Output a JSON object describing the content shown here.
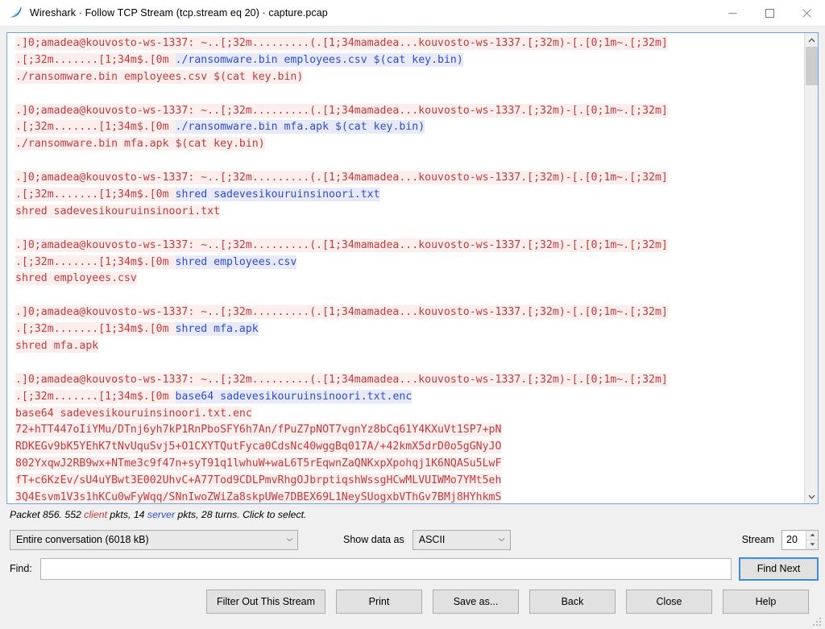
{
  "window": {
    "title": "Wireshark · Follow TCP Stream (tcp.stream eq 20) · capture.pcap",
    "logo_icon": "wireshark-shark-fin-icon",
    "minimize_icon": "minimize-icon",
    "maximize_icon": "maximize-icon",
    "close_icon": "close-icon"
  },
  "colors": {
    "server_text": "#c23b3b",
    "server_bg": "#fdeeee",
    "client_text": "#2b4fcf",
    "client_bg": "#e9eaf9",
    "pane_border": "#69a5e8",
    "focus_border": "#3d8bdb"
  },
  "stream_content": {
    "blocks": [
      {
        "prompt": ".]0;amadea@kouvosto-ws-1337: ~..[;32m.........(.[1;34mamadea...kouvosto-ws-1337.[;32m)-[.[0;1m~.[;32m]",
        "prompt_prefix": ".[;32m.......[1;34m$.[0m ",
        "command": "./ransomware.bin employees.csv $(cat key.bin)",
        "echo": "./ransomware.bin employees.csv $(cat key.bin)",
        "output": []
      },
      {
        "prompt": ".]0;amadea@kouvosto-ws-1337: ~..[;32m.........(.[1;34mamadea...kouvosto-ws-1337.[;32m)-[.[0;1m~.[;32m]",
        "prompt_prefix": ".[;32m.......[1;34m$.[0m ",
        "command": "./ransomware.bin mfa.apk $(cat key.bin)",
        "echo": "./ransomware.bin mfa.apk $(cat key.bin)",
        "output": []
      },
      {
        "prompt": ".]0;amadea@kouvosto-ws-1337: ~..[;32m.........(.[1;34mamadea...kouvosto-ws-1337.[;32m)-[.[0;1m~.[;32m]",
        "prompt_prefix": ".[;32m.......[1;34m$.[0m ",
        "command": "shred sadevesikouruinsinoori.txt",
        "echo": "shred sadevesikouruinsinoori.txt",
        "output": []
      },
      {
        "prompt": ".]0;amadea@kouvosto-ws-1337: ~..[;32m.........(.[1;34mamadea...kouvosto-ws-1337.[;32m)-[.[0;1m~.[;32m]",
        "prompt_prefix": ".[;32m.......[1;34m$.[0m ",
        "command": "shred employees.csv",
        "echo": "shred employees.csv",
        "output": []
      },
      {
        "prompt": ".]0;amadea@kouvosto-ws-1337: ~..[;32m.........(.[1;34mamadea...kouvosto-ws-1337.[;32m)-[.[0;1m~.[;32m]",
        "prompt_prefix": ".[;32m.......[1;34m$.[0m ",
        "command": "shred mfa.apk",
        "echo": "shred mfa.apk",
        "output": []
      },
      {
        "prompt": ".]0;amadea@kouvosto-ws-1337: ~..[;32m.........(.[1;34mamadea...kouvosto-ws-1337.[;32m)-[.[0;1m~.[;32m]",
        "prompt_prefix": ".[;32m.......[1;34m$.[0m ",
        "command": "base64 sadevesikouruinsinoori.txt.enc",
        "echo": "base64 sadevesikouruinsinoori.txt.enc",
        "output": [
          "72+hTT447oIiYMu/DTnj6yh7kP1RnPboSFY6h7An/fPuZ7pNOT7vgnYz8bCq61Y4KXuVt1SP7+pN",
          "RDKEGv9bK5YEhK7tNvUquSvj5+O1CXYTQutFyca0CdsNc40wggBq017A/+42kmX5drD0o5gGNyJO",
          "802YxqwJ2RB9wx+NTme3c9f47n+syT91q1lwhuW+waL6T5rEqwnZaQNKxpXpohqj1K6NQASu5LwF",
          "fT+c6KzEv/sU4uYBwt3E002UhvC+A77Tod9CDLPmvRhgOJbrptiqshWssgHCwMLVUIWMo7YMt5eh",
          "3Q4Esvm1V3s1hKCu0wFyWqq/SNnIwoZWiZa8skpUWe7DBEX69L1NeySUogxbVThGv7BMj8HYhkmS"
        ]
      }
    ]
  },
  "status": {
    "prefix": "Packet 856. 552 ",
    "client_word": "client",
    "mid": " pkts, 14 ",
    "server_word": "server",
    "suffix": " pkts, 28 turns. Click to select."
  },
  "controls": {
    "conversation_value": "Entire conversation (6018 kB)",
    "show_data_as_label": "Show data as",
    "format_value": "ASCII",
    "stream_label": "Stream",
    "stream_value": "20",
    "dropdown_icon": "chevron-down-icon",
    "spinner_up_icon": "spinner-up-icon",
    "spinner_down_icon": "spinner-down-icon"
  },
  "find": {
    "label": "Find:",
    "value": "",
    "placeholder": "",
    "find_next_label": "Find Next"
  },
  "buttons": {
    "filter_out": "Filter Out This Stream",
    "print": "Print",
    "save_as": "Save as...",
    "back": "Back",
    "close": "Close",
    "help": "Help"
  },
  "scrollbar": {
    "up_icon": "scroll-up-icon",
    "down_icon": "scroll-down-icon"
  }
}
